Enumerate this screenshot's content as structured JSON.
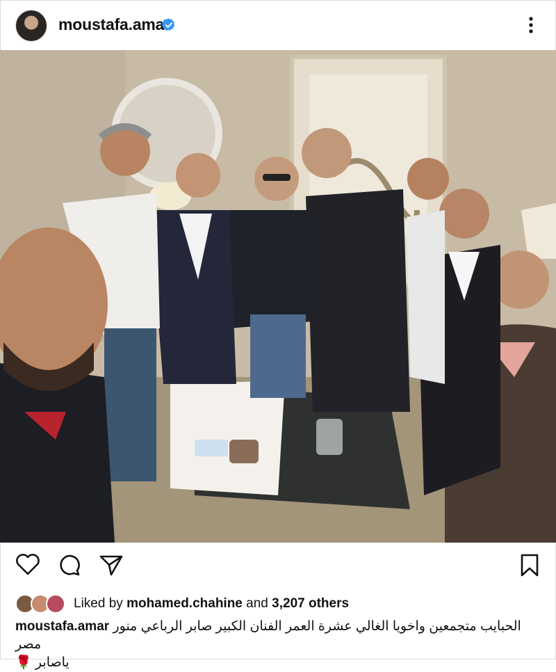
{
  "post": {
    "username": "moustafa.amar",
    "verified_icon": "verified-badge-icon",
    "more_icon": "more-vertical-icon"
  },
  "actions": {
    "like_icon": "heart-icon",
    "comment_icon": "comment-icon",
    "share_icon": "send-icon",
    "save_icon": "bookmark-icon"
  },
  "likes": {
    "prefix": "Liked by",
    "user": "mohamed.chahine",
    "and": "and",
    "others": "3,207 others"
  },
  "caption": {
    "username": "moustafa.amar",
    "text_line1": "الحبايب متجمعين واخويا الغالي عشرة العمر الفنان الكبير صابر الرباعي منور مصر",
    "text_line2": "ياصابر 🌹"
  },
  "colors": {
    "verified_blue": "#3897f0",
    "text": "#111111",
    "border": "#dbdbdb"
  }
}
